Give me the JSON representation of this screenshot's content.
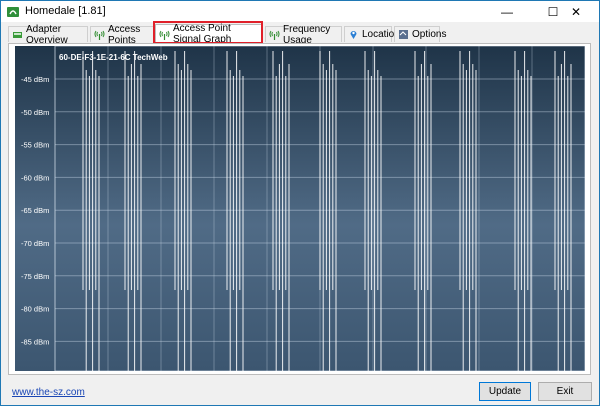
{
  "window": {
    "title": "Homedale [1.81]",
    "controls": {
      "minimize": "—",
      "maximize": "☐",
      "close": "✕"
    }
  },
  "tabs": [
    {
      "label": "Adapter Overview",
      "icon": "adapter-icon",
      "active": false
    },
    {
      "label": "Access Points",
      "icon": "antenna-icon",
      "active": false
    },
    {
      "label": "Access Point Signal Graph",
      "icon": "antenna-icon",
      "active": true
    },
    {
      "label": "Frequency Usage",
      "icon": "antenna-icon",
      "active": false
    },
    {
      "label": "Location",
      "icon": "location-pin-icon",
      "active": false
    },
    {
      "label": "Options",
      "icon": "settings-icon",
      "active": false
    }
  ],
  "graph": {
    "series_label": "60-DE-F3-1E-21-6C TechWeb",
    "y_ticks": [
      "-45 dBm",
      "-50 dBm",
      "-55 dBm",
      "-60 dBm",
      "-65 dBm",
      "-70 dBm",
      "-75 dBm",
      "-80 dBm",
      "-85 dBm"
    ],
    "colors": {
      "background_top": "#1f3448",
      "background_bottom": "#5b7590",
      "line": "#ffffff"
    }
  },
  "footer": {
    "link": "www.the-sz.com",
    "update_label": "Update",
    "exit_label": "Exit"
  }
}
